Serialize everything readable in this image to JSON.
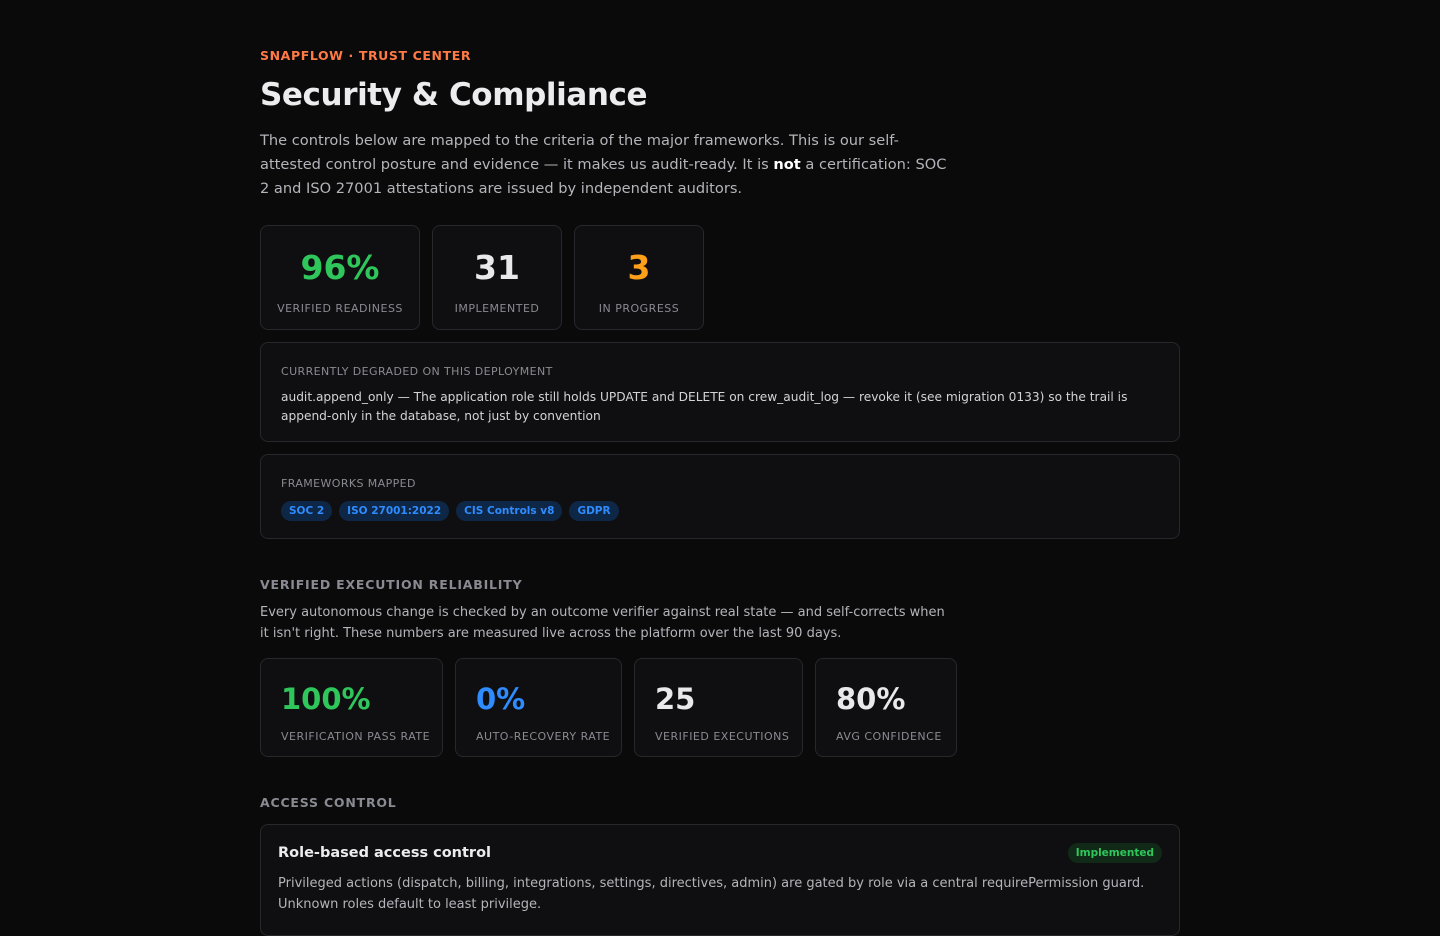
{
  "header": {
    "eyebrow": "SNAPFLOW · TRUST CENTER",
    "title": "Security & Compliance",
    "intro_before": "The controls below are mapped to the criteria of the major frameworks. This is our self-attested control posture and evidence — it makes us audit-ready. It is ",
    "intro_bold": "not",
    "intro_after": " a certification: SOC 2 and ISO 27001 attestations are issued by independent auditors."
  },
  "stats": [
    {
      "value": "96%",
      "label": "VERIFIED READINESS",
      "color": "#2fc75b"
    },
    {
      "value": "31",
      "label": "IMPLEMENTED",
      "color": "#e9e9ec"
    },
    {
      "value": "3",
      "label": "IN PROGRESS",
      "color": "#ff9f1a"
    }
  ],
  "degraded": {
    "caption": "CURRENTLY DEGRADED ON THIS DEPLOYMENT",
    "text": "audit.append_only — The application role still holds UPDATE and DELETE on crew_audit_log — revoke it (see migration 0133) so the trail is append-only in the database, not just by convention"
  },
  "frameworks": {
    "caption": "FRAMEWORKS MAPPED",
    "items": [
      "SOC 2",
      "ISO 27001:2022",
      "CIS Controls v8",
      "GDPR"
    ]
  },
  "reliability": {
    "heading": "VERIFIED EXECUTION RELIABILITY",
    "description": "Every autonomous change is checked by an outcome verifier against real state — and self-corrects when it isn't right. These numbers are measured live across the platform over the last 90 days.",
    "metrics": [
      {
        "value": "100%",
        "label": "VERIFICATION PASS RATE",
        "color": "#2fc75b"
      },
      {
        "value": "0%",
        "label": "AUTO-RECOVERY RATE",
        "color": "#2f8cff"
      },
      {
        "value": "25",
        "label": "VERIFIED EXECUTIONS",
        "color": "#e9e9ec"
      },
      {
        "value": "80%",
        "label": "AVG CONFIDENCE",
        "color": "#e9e9ec"
      }
    ]
  },
  "access_control": {
    "heading": "ACCESS CONTROL",
    "control": {
      "name": "Role-based access control",
      "status": "Implemented",
      "description": "Privileged actions (dispatch, billing, integrations, settings, directives, admin) are gated by role via a central requirePermission guard. Unknown roles default to least privilege."
    }
  }
}
